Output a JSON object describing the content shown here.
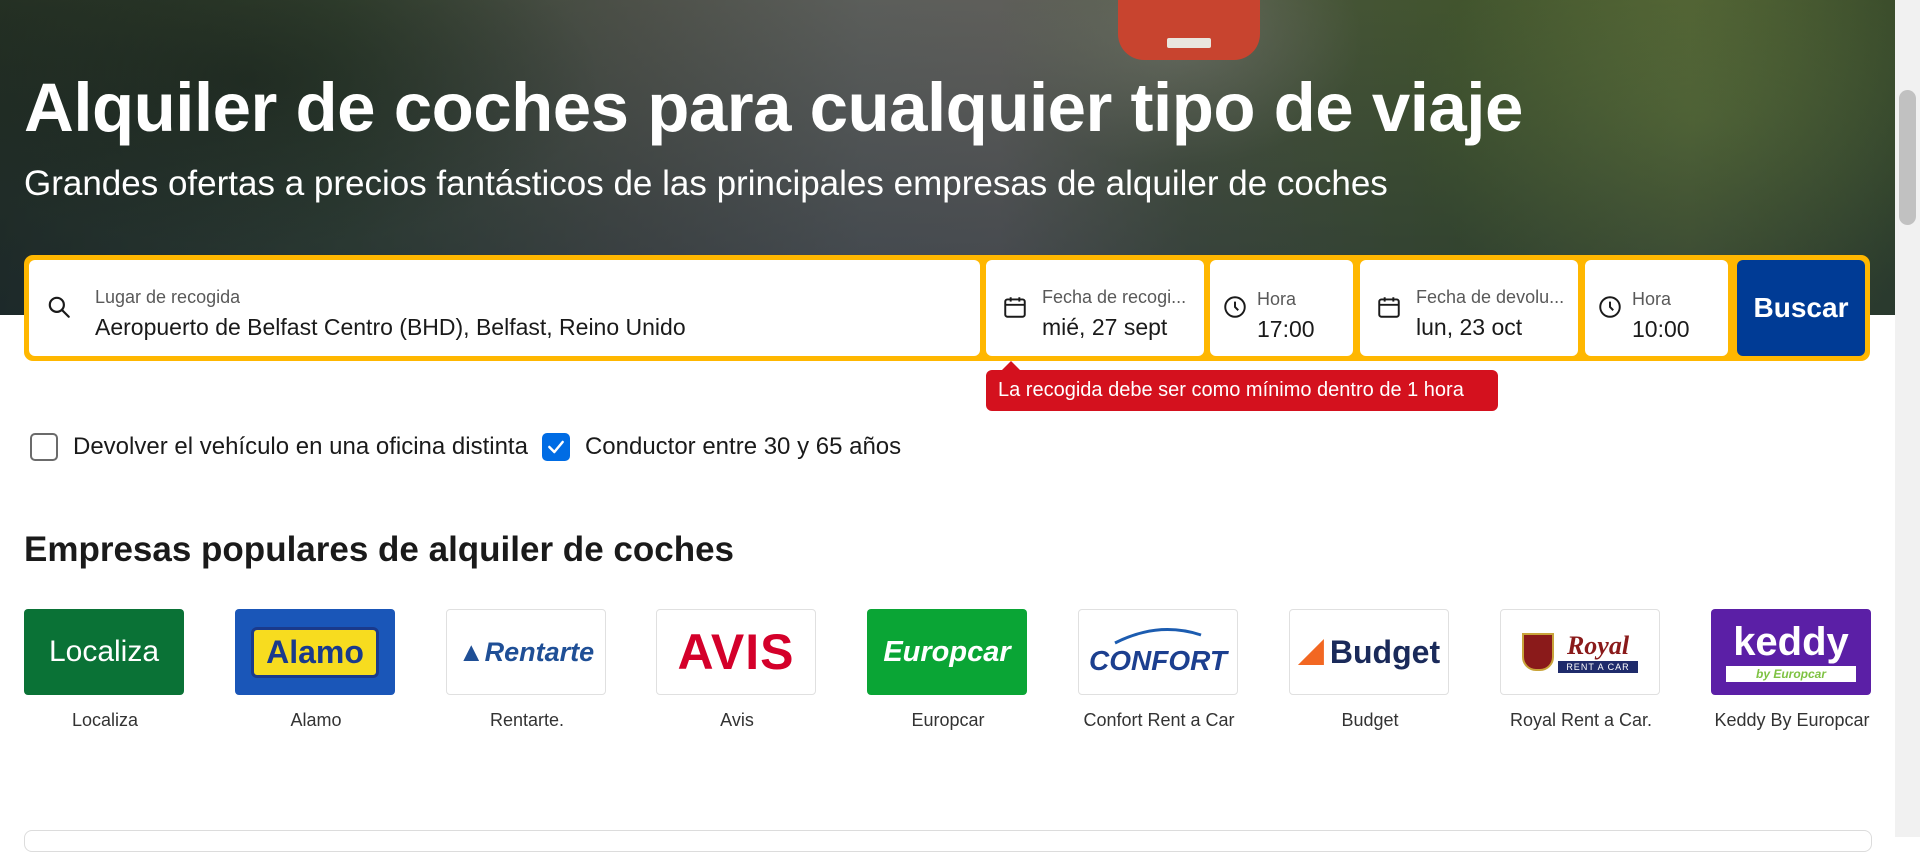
{
  "hero": {
    "title": "Alquiler de coches para cualquier tipo de viaje",
    "subtitle": "Grandes ofertas a precios fantásticos de las principales empresas de alquiler de coches"
  },
  "search": {
    "pickup_location_label": "Lugar de recogida",
    "pickup_location_value": "Aeropuerto de Belfast Centro (BHD), Belfast, Reino Unido",
    "pickup_date_label": "Fecha de recogi...",
    "pickup_date_value": "mié, 27 sept",
    "pickup_time_label": "Hora",
    "pickup_time_value": "17:00",
    "return_date_label": "Fecha de devolu...",
    "return_date_value": "lun, 23 oct",
    "return_time_label": "Hora",
    "return_time_value": "10:00",
    "button_label": "Buscar",
    "error_message": "La recogida debe ser como mínimo dentro de 1 hora"
  },
  "options": {
    "different_return": {
      "label": "Devolver el vehículo en una oficina distinta",
      "checked": false
    },
    "driver_age": {
      "label": "Conductor entre 30 y 65 años",
      "checked": true
    }
  },
  "brands_section": {
    "title": "Empresas populares de alquiler de coches",
    "brands": [
      {
        "name": "Localiza",
        "logo_text": "Localiza",
        "icon": "localiza-logo"
      },
      {
        "name": "Alamo",
        "logo_text": "Alamo",
        "icon": "alamo-logo"
      },
      {
        "name": "Rentarte.",
        "logo_text": "Rentarte",
        "icon": "rentarte-logo"
      },
      {
        "name": "Avis",
        "logo_text": "AVIS",
        "icon": "avis-logo"
      },
      {
        "name": "Europcar",
        "logo_text": "Europcar",
        "icon": "europcar-logo"
      },
      {
        "name": "Confort Rent a Car",
        "logo_text": "CONFORT",
        "icon": "confort-logo"
      },
      {
        "name": "Budget",
        "logo_text": "Budget",
        "icon": "budget-logo"
      },
      {
        "name": "Royal Rent a Car.",
        "logo_text": "Royal",
        "logo_subtext": "RENT A CAR",
        "icon": "royal-logo"
      },
      {
        "name": "Keddy By Europcar",
        "logo_text": "keddy",
        "logo_subtext": "by Europcar",
        "icon": "keddy-logo"
      }
    ]
  },
  "colors": {
    "search_border": "#ffb700",
    "search_button": "#003b95",
    "error_bg": "#d4111e",
    "checkbox_checked": "#006ce4"
  }
}
